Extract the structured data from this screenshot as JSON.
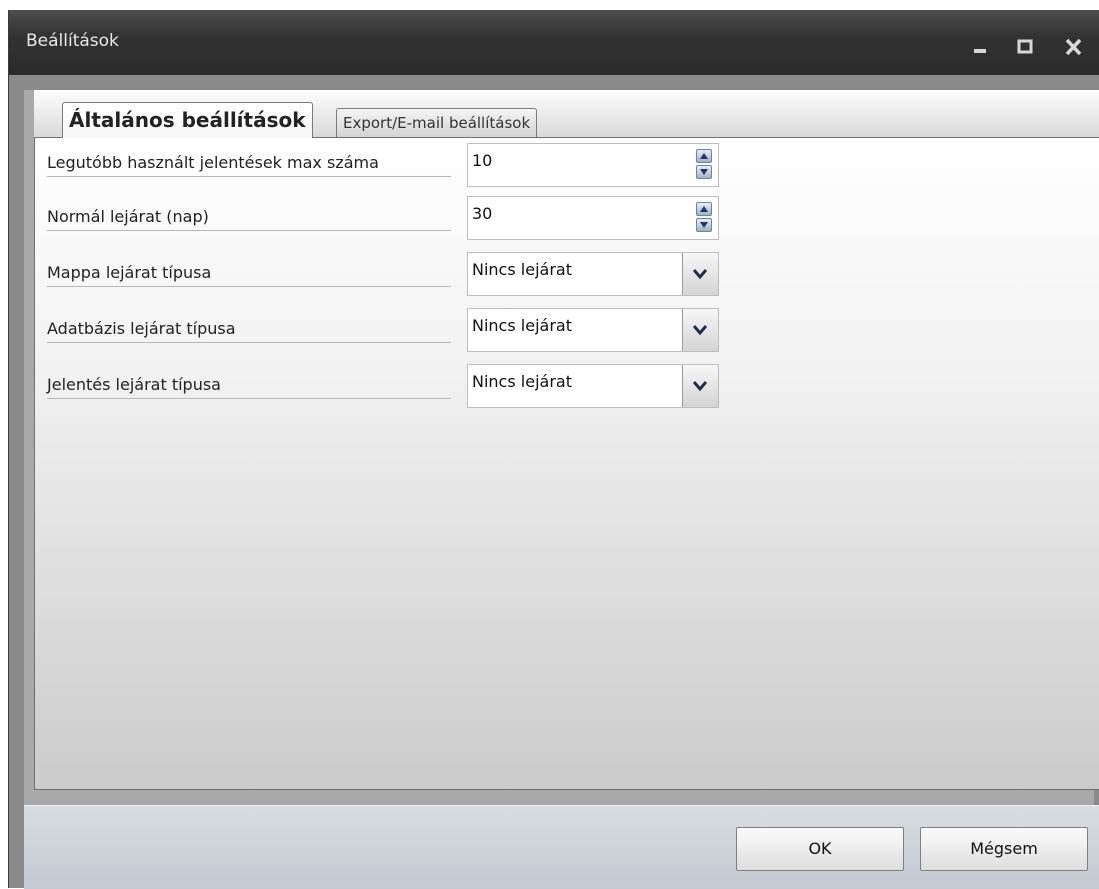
{
  "window": {
    "title": "Beállítások"
  },
  "tabs": [
    {
      "label": "Általános beállítások",
      "active": true
    },
    {
      "label": "Export/E-mail beállítások",
      "active": false
    }
  ],
  "settings": [
    {
      "label": "Legutóbb használt jelentések max száma",
      "value": "10",
      "control": "spinner"
    },
    {
      "label": "Normál lejárat (nap)",
      "value": "30",
      "control": "spinner"
    },
    {
      "label": "Mappa lejárat típusa",
      "value": "Nincs lejárat",
      "control": "dropdown"
    },
    {
      "label": "Adatbázis lejárat típusa",
      "value": "Nincs lejárat",
      "control": "dropdown"
    },
    {
      "label": "Jelentés lejárat típusa",
      "value": "Nincs lejárat",
      "control": "dropdown"
    }
  ],
  "buttons": {
    "ok": "OK",
    "cancel": "Mégsem"
  },
  "icons": {
    "minimize": "minimize-icon",
    "maximize": "maximize-icon",
    "close": "close-icon",
    "spin_up": "arrow-up-icon",
    "spin_down": "arrow-down-icon",
    "dropdown": "chevron-down-icon"
  }
}
